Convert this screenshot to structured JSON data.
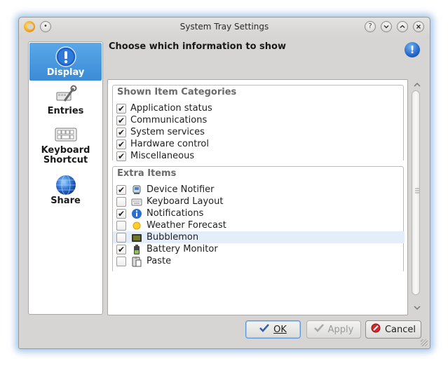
{
  "window": {
    "title": "System Tray Settings"
  },
  "titlebar_buttons": [
    {
      "name": "help-icon",
      "glyph": "?"
    },
    {
      "name": "minimize-icon",
      "glyph": "⌄"
    },
    {
      "name": "maximize-icon",
      "glyph": "⌃"
    },
    {
      "name": "close-icon",
      "glyph": "✕"
    }
  ],
  "sidebar": {
    "items": [
      {
        "label": "Display",
        "icon": "info-icon",
        "selected": true
      },
      {
        "label": "Entries",
        "icon": "tools-icon",
        "selected": false
      },
      {
        "label": "Keyboard Shortcut",
        "icon": "keyboard-icon",
        "selected": false
      },
      {
        "label": "Share",
        "icon": "globe-icon",
        "selected": false
      }
    ]
  },
  "header": {
    "title": "Choose which information to show",
    "icon": "info-icon"
  },
  "shown_categories": {
    "title": "Shown Item Categories",
    "items": [
      {
        "label": "Application status",
        "checked": true
      },
      {
        "label": "Communications",
        "checked": true
      },
      {
        "label": "System services",
        "checked": true
      },
      {
        "label": "Hardware control",
        "checked": true
      },
      {
        "label": "Miscellaneous",
        "checked": true
      }
    ]
  },
  "extra_items": {
    "title": "Extra Items",
    "items": [
      {
        "label": "Device Notifier",
        "checked": true,
        "icon": "device-notifier-icon"
      },
      {
        "label": "Keyboard Layout",
        "checked": false,
        "icon": "keyboard-layout-icon"
      },
      {
        "label": "Notifications",
        "checked": true,
        "icon": "notifications-icon"
      },
      {
        "label": "Weather Forecast",
        "checked": false,
        "icon": "weather-icon"
      },
      {
        "label": "Bubblemon",
        "checked": false,
        "icon": "bubblemon-icon",
        "hovered": true
      },
      {
        "label": "Battery Monitor",
        "checked": true,
        "icon": "battery-icon"
      },
      {
        "label": "Paste",
        "checked": false,
        "icon": "paste-icon"
      }
    ]
  },
  "buttons": {
    "ok": "OK",
    "apply": "Apply",
    "cancel": "Cancel"
  },
  "colors": {
    "selection": "#3b8bd6",
    "window_bg": "#d6d5d3",
    "glow": "#5a96d7"
  }
}
